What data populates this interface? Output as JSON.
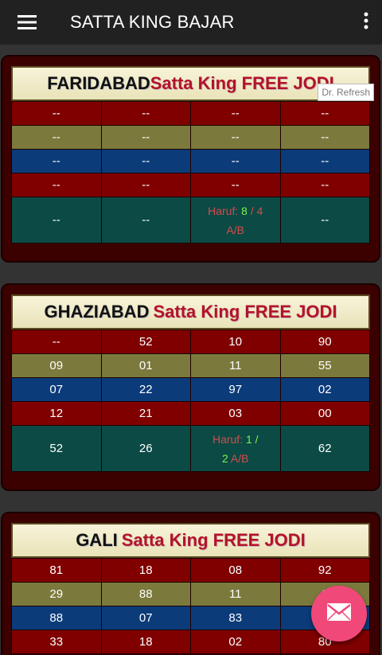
{
  "app": {
    "title": "SATTA KING BAJAR"
  },
  "icons": {
    "menu": "menu-icon",
    "more": "more-vert-icon",
    "mail": "mail-icon"
  },
  "colors": {
    "appbar": "#212121",
    "fab": "#f1487a",
    "row_maroon": "#800000",
    "row_olive": "#7b7a3c",
    "row_blue": "#0c3b7a",
    "row_teal": "#0b4a45"
  },
  "cards": [
    {
      "city": "FARIDABAD",
      "tag": "Satta King FREE JODI",
      "refresh_label": "Dr. Refresh",
      "rows": [
        [
          "--",
          "--",
          "--",
          "--"
        ],
        [
          "--",
          "--",
          "--",
          "--"
        ],
        [
          "--",
          "--",
          "--",
          "--"
        ],
        [
          "--",
          "--",
          "--",
          "--"
        ]
      ],
      "last_row": {
        "c1": "--",
        "c2": "--",
        "haruf_label": "Haruf:",
        "haruf_a": "8",
        "haruf_sep": "/",
        "haruf_b": "4",
        "haruf_suffix": "A/B",
        "c4": "--"
      }
    },
    {
      "city": "GHAZIABAD",
      "tag": "Satta King FREE JODI",
      "rows": [
        [
          "--",
          "52",
          "10",
          "90"
        ],
        [
          "09",
          "01",
          "11",
          "55"
        ],
        [
          "07",
          "22",
          "97",
          "02"
        ],
        [
          "12",
          "21",
          "03",
          "00"
        ]
      ],
      "last_row": {
        "c1": "52",
        "c2": "26",
        "haruf_label": "Haruf:",
        "haruf_a": "1",
        "haruf_sep": "/",
        "haruf_b": "2",
        "haruf_suffix": "A/B",
        "c4": "62"
      }
    },
    {
      "city": "GALI",
      "tag": "Satta King FREE JODI",
      "rows": [
        [
          "81",
          "18",
          "08",
          "92"
        ],
        [
          "29",
          "88",
          "11",
          "9"
        ],
        [
          "88",
          "07",
          "83",
          ""
        ],
        [
          "33",
          "18",
          "02",
          "80"
        ]
      ]
    }
  ]
}
